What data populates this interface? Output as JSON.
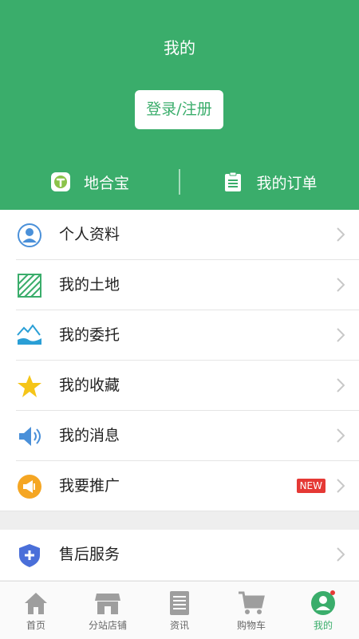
{
  "header": {
    "title": "我的",
    "login_label": "登录/注册",
    "quick_left": "地合宝",
    "quick_right": "我的订单"
  },
  "menu": {
    "items": [
      {
        "label": "个人资料",
        "icon": "person-icon"
      },
      {
        "label": "我的土地",
        "icon": "land-icon"
      },
      {
        "label": "我的委托",
        "icon": "mountain-hand-icon"
      },
      {
        "label": "我的收藏",
        "icon": "star-icon"
      },
      {
        "label": "我的消息",
        "icon": "speaker-icon"
      },
      {
        "label": "我要推广",
        "icon": "megaphone-icon",
        "badge": "NEW"
      }
    ],
    "after_sale": {
      "label": "售后服务",
      "icon": "shield-plus-icon"
    }
  },
  "tabbar": {
    "tabs": [
      {
        "label": "首页",
        "icon": "home-icon"
      },
      {
        "label": "分站店铺",
        "icon": "store-icon"
      },
      {
        "label": "资讯",
        "icon": "document-icon"
      },
      {
        "label": "购物车",
        "icon": "cart-icon"
      },
      {
        "label": "我的",
        "icon": "profile-icon",
        "active": true
      }
    ]
  },
  "colors": {
    "primary": "#3aad6b",
    "badge": "#e53935"
  }
}
